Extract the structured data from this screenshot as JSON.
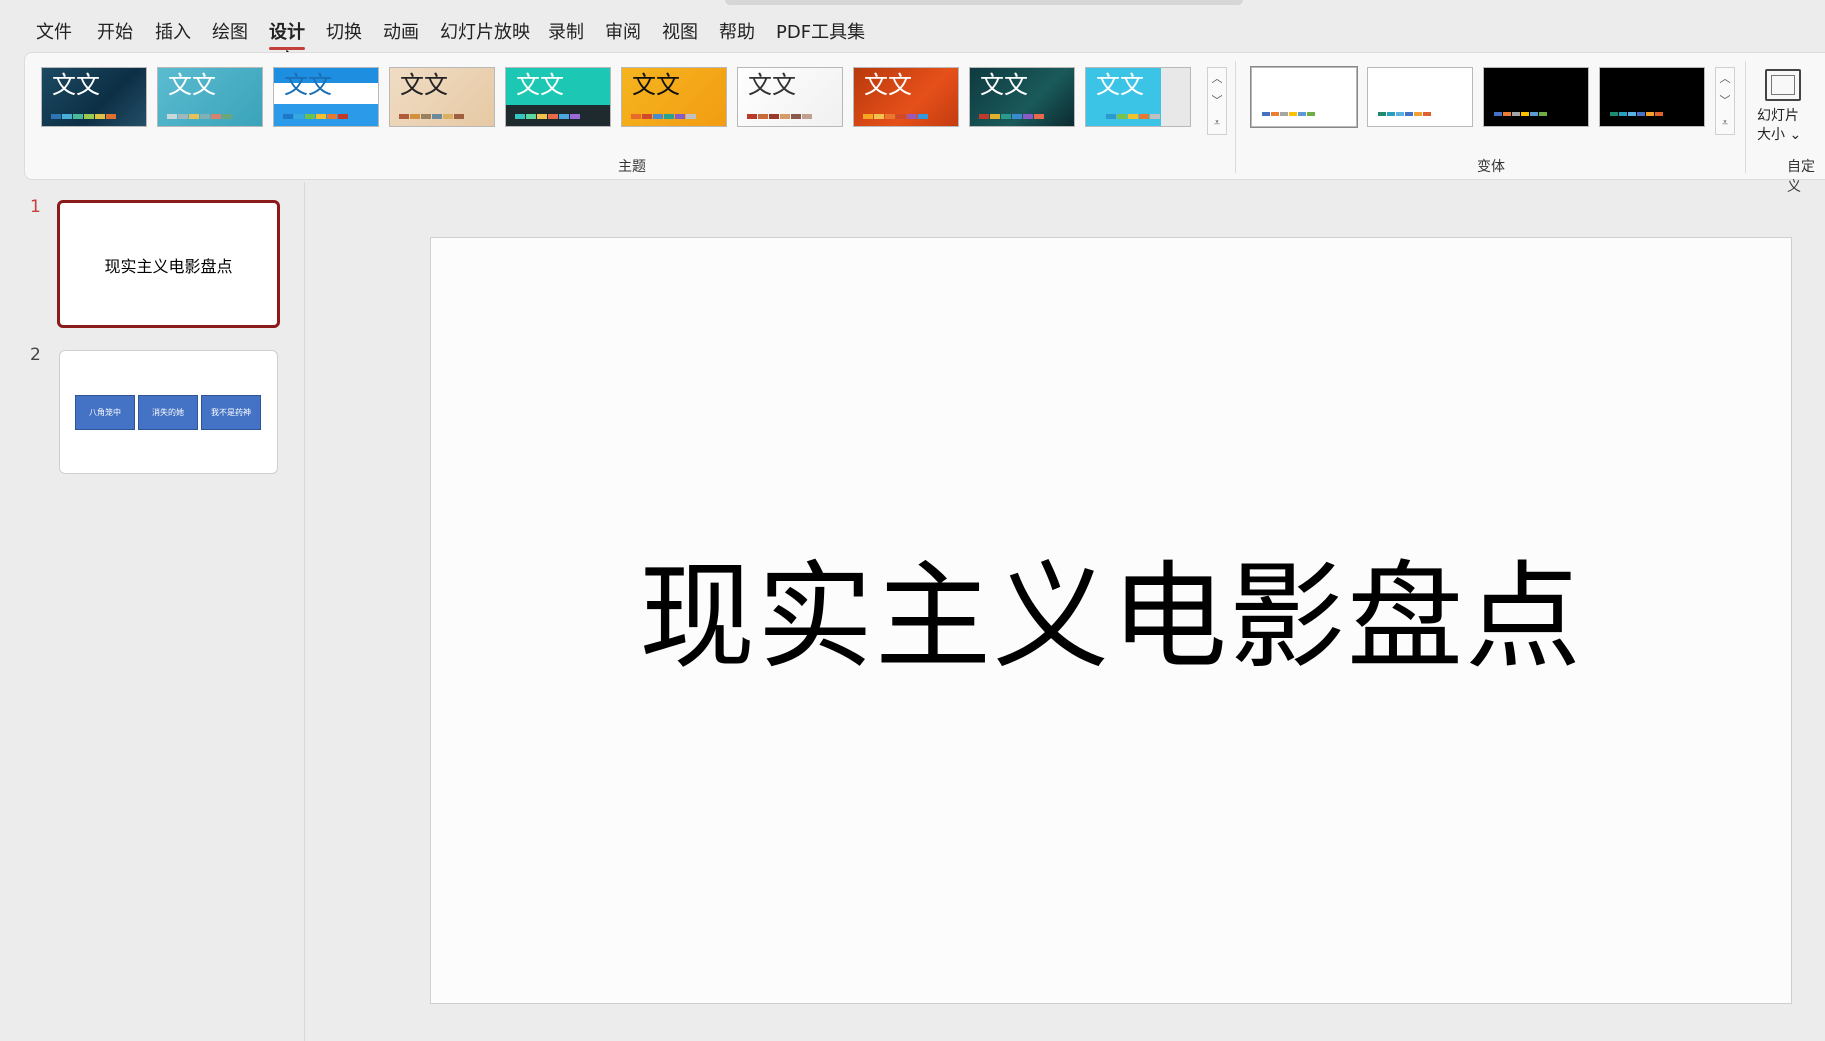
{
  "menu": {
    "tabs": [
      "文件",
      "开始",
      "插入",
      "绘图",
      "设计",
      "切换",
      "动画",
      "幻灯片放映",
      "录制",
      "审阅",
      "视图",
      "帮助",
      "PDF工具集"
    ],
    "active_tab": "设计"
  },
  "ribbon": {
    "themes": [
      {
        "text": "文文",
        "text_color": "#ffffff",
        "bg": "linear-gradient(135deg,#1b4a63,#0d2f45 60%,#234f68)",
        "bars": [
          "#2e75b6",
          "#48b0d8",
          "#4bb89b",
          "#9bc84f",
          "#e0c040",
          "#e07030"
        ]
      },
      {
        "text": "文文",
        "text_color": "#ffffff",
        "bg": "linear-gradient(135deg,#5bbcd0,#3aa3ba)",
        "bars": [
          "#c8d7da",
          "#9fb8bd",
          "#e8c05a",
          "#7fb0b8",
          "#d6826d",
          "#6aa67e"
        ]
      },
      {
        "text": "文文",
        "text_color": "#1a6fb5",
        "bg": "linear-gradient(#1e8fe0 0 26%,#ffffff 26% 62%,#2b9ae8 62%)",
        "bars": [
          "#1e78c8",
          "#35a8e0",
          "#6cc24a",
          "#f2c12e",
          "#e8782e",
          "#c0392b"
        ]
      },
      {
        "text": "文文",
        "text_color": "#222222",
        "bg": "linear-gradient(135deg,#f0dcc4,#e6c9a4)",
        "bars": [
          "#b05a3c",
          "#d2903c",
          "#9a8060",
          "#6a8a9a",
          "#d8b060",
          "#a06040"
        ]
      },
      {
        "text": "文文",
        "text_color": "#ffffff",
        "bg": "linear-gradient(#1cc7b4 0 64%,#1f2a2f 64%)",
        "bars": [
          "#34c6c0",
          "#5dd6a0",
          "#f2c14e",
          "#e86a4a",
          "#4aa8e0",
          "#9a6ad6"
        ]
      },
      {
        "text": "文文",
        "text_color": "#111111",
        "bg": "linear-gradient(135deg,#f5b51f,#f29c12)",
        "bars": [
          "#e86a2a",
          "#d04a2a",
          "#4a8ad0",
          "#2aa090",
          "#8a5ac8",
          "#c0c0c0"
        ]
      },
      {
        "text": "文文",
        "text_color": "#333333",
        "bg": "linear-gradient(135deg,#ffffff,#f0f0f0)",
        "bars": [
          "#b83a2a",
          "#c86a3a",
          "#9a3a2a",
          "#d89a6a",
          "#8a5a4a",
          "#c0a090"
        ]
      },
      {
        "text": "文文",
        "text_color": "#ffffff",
        "bg": "linear-gradient(135deg,#b8390c,#e6501a 60%,#c43c10)",
        "bars": [
          "#f5a623",
          "#f2c14e",
          "#e8782e",
          "#d04a2a",
          "#9b59b6",
          "#3498db"
        ]
      },
      {
        "text": "文文",
        "text_color": "#ffffff",
        "bg": "linear-gradient(135deg,#0e3a40,#1a5a5a 60%,#0c2a30)",
        "bars": [
          "#c0392b",
          "#e0b030",
          "#2a9a8a",
          "#3a8ad0",
          "#8a5ac8",
          "#e86a4a"
        ]
      },
      {
        "text": "文文",
        "text_color": "#ffffff",
        "bg": "linear-gradient(90deg,#3cc4e6 0 72%,#e8e8e8 72%)",
        "bars": [
          "#3cc4e6",
          "#2a9ad0",
          "#7ac24a",
          "#f2c12e",
          "#e8782e",
          "#c0c0c0"
        ]
      }
    ],
    "themes_group_label": "主题",
    "variants": [
      {
        "bg": "#ffffff",
        "bars": [
          "#4472c4",
          "#ed7d31",
          "#a5a5a5",
          "#ffc000",
          "#5b9bd5",
          "#70ad47"
        ]
      },
      {
        "bg": "#ffffff",
        "bars": [
          "#1f8a70",
          "#2aa0c0",
          "#5ab0e0",
          "#4472c4",
          "#f2a030",
          "#e06030"
        ]
      },
      {
        "bg": "#000000",
        "bars": [
          "#4472c4",
          "#ed7d31",
          "#a5a5a5",
          "#ffc000",
          "#5b9bd5",
          "#70ad47"
        ]
      },
      {
        "bg": "#000000",
        "bars": [
          "#1f8a70",
          "#2aa0c0",
          "#5ab0e0",
          "#4472c4",
          "#f2a030",
          "#e06030"
        ]
      }
    ],
    "variants_group_label": "变体",
    "slide_size_line1": "幻灯片",
    "slide_size_line2": "大小 ⌄",
    "customize_group_label": "自定义"
  },
  "slides": [
    {
      "number": "1",
      "title": "现实主义电影盘点"
    },
    {
      "number": "2",
      "buttons": [
        "八角笼中",
        "消失的她",
        "我不是药神"
      ]
    }
  ],
  "canvas": {
    "title": "现实主义电影盘点"
  }
}
